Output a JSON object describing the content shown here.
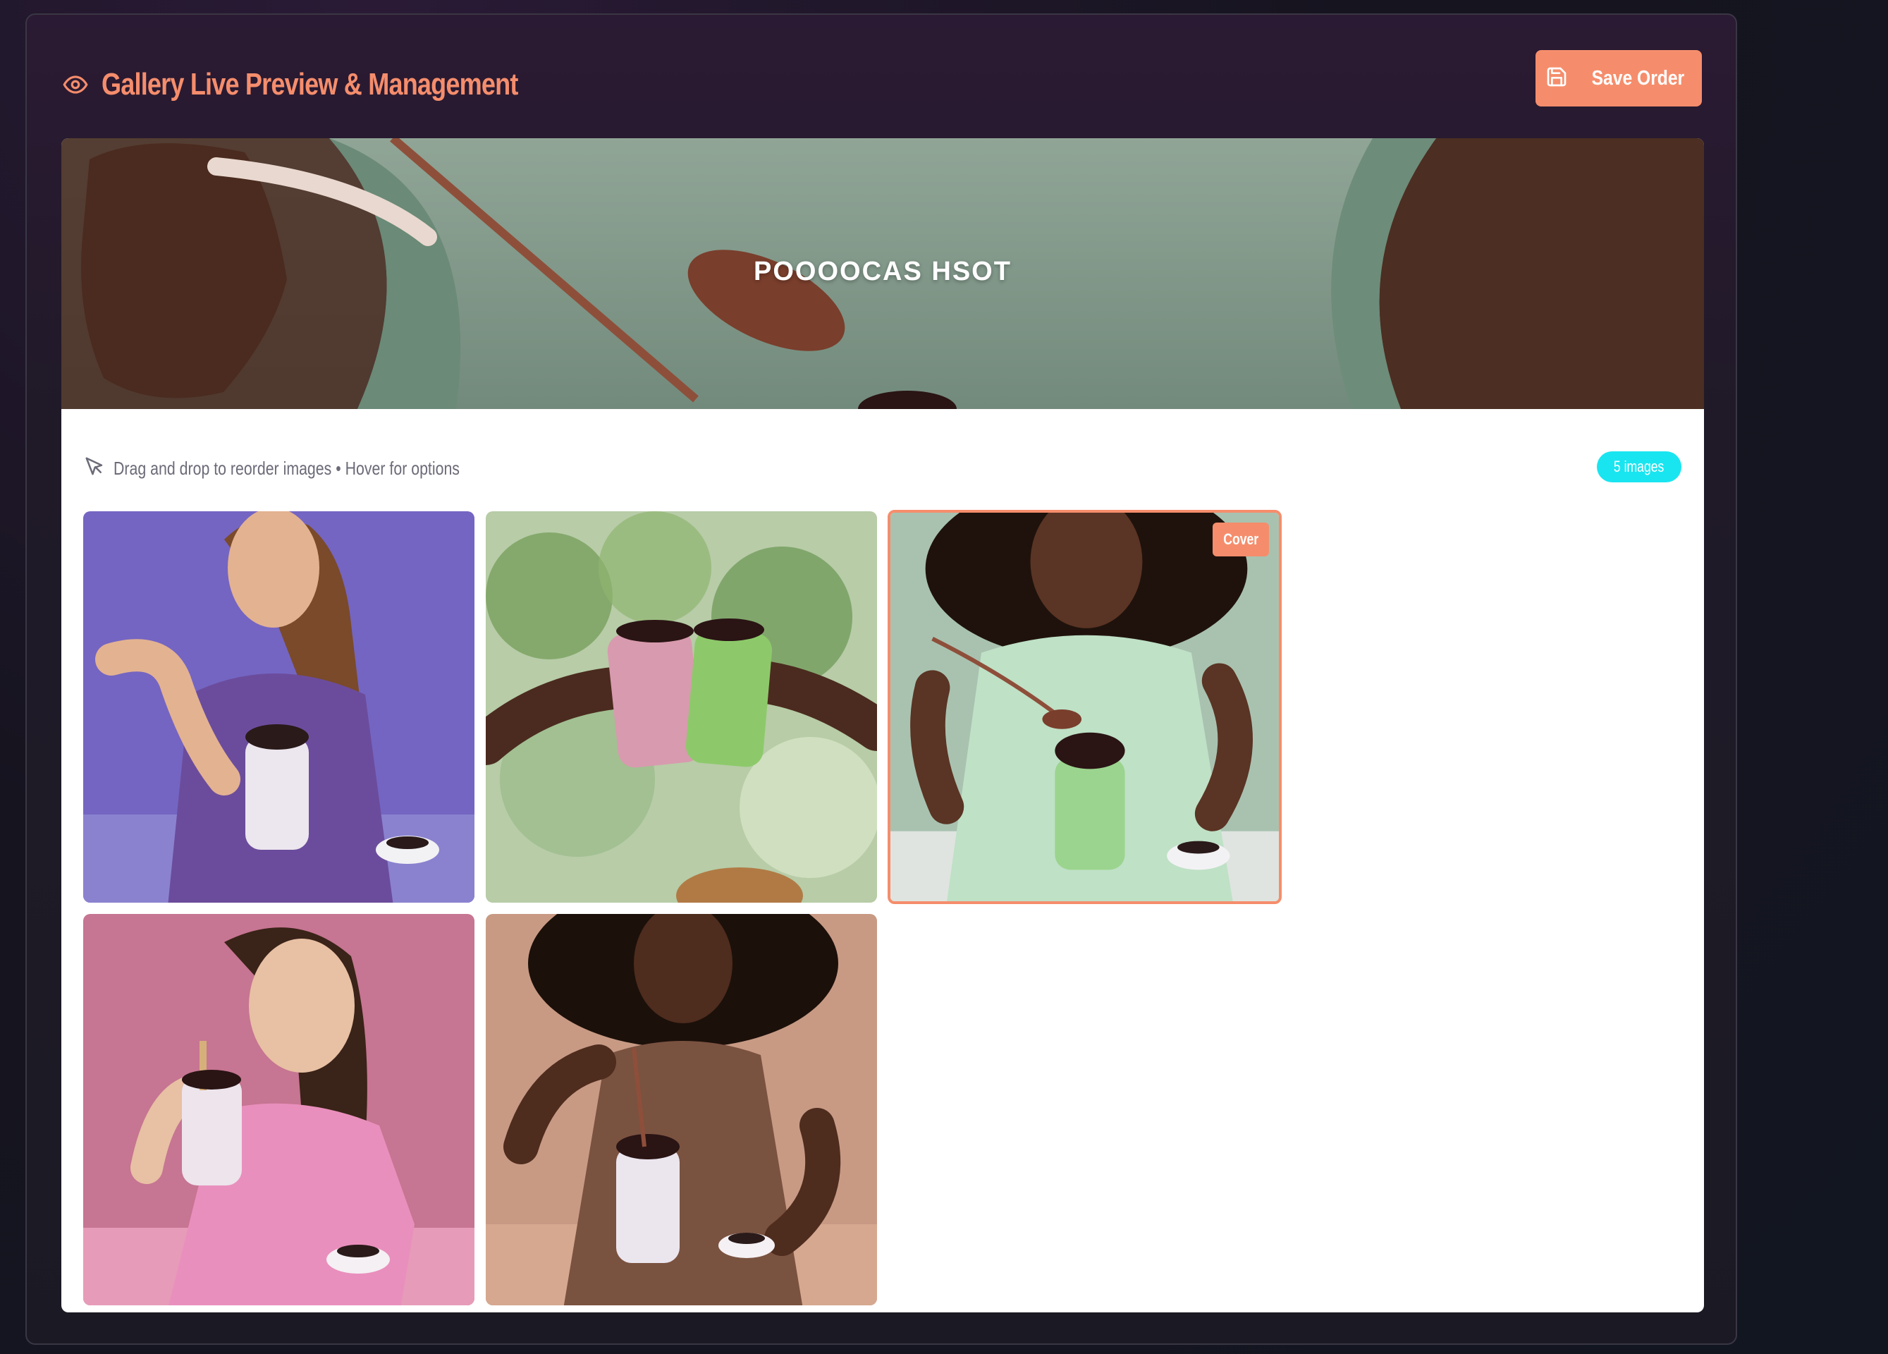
{
  "header": {
    "title": "Gallery Live Preview & Management",
    "title_icon": "eye-icon",
    "save_button": {
      "label": "Save Order",
      "icon": "floppy-disk-icon"
    }
  },
  "banner": {
    "title": "POOOOCAS HSOT"
  },
  "toolbar": {
    "hint": "Drag and drop to reorder images • Hover for options",
    "hint_icon": "cursor-pointer-icon",
    "image_count": "5 images"
  },
  "gallery": {
    "images": [
      {
        "subject": "woman in purple top eating from glass jar",
        "is_cover": false
      },
      {
        "subject": "two hands toasting pink and green drinks",
        "is_cover": false
      },
      {
        "subject": "woman in mint top with green drink",
        "is_cover": true,
        "badge": "Cover"
      },
      {
        "subject": "woman in pink top holding drink",
        "is_cover": false
      },
      {
        "subject": "woman in brown top stirring drink",
        "is_cover": false
      }
    ]
  },
  "colors": {
    "accent": "#f58d6c",
    "badge_cyan": "#19e5f0",
    "panel_bg": "#201a28",
    "content_bg": "#ffffff"
  }
}
